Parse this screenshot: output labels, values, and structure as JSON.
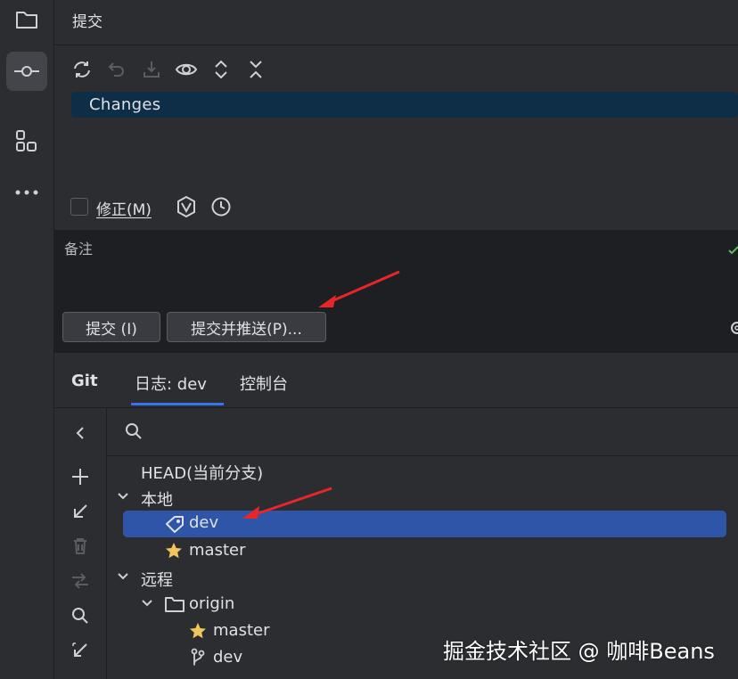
{
  "activity_bar": {
    "items": [
      {
        "name": "project",
        "icon": "folder-icon"
      },
      {
        "name": "commit",
        "icon": "commit-icon",
        "active": true
      },
      {
        "name": "structure",
        "icon": "structure-icon"
      },
      {
        "name": "more",
        "icon": "more-icon"
      }
    ]
  },
  "commit_panel": {
    "title": "提交",
    "toolbar": [
      "refresh-icon",
      "rollback-icon",
      "shelve-icon",
      "eye-icon",
      "expand-all-icon",
      "collapse-all-icon"
    ],
    "changes_label": "Changes",
    "amend_label": "修正(M)",
    "message_placeholder": "备注",
    "commit_button": "提交 (I)",
    "commit_push_button": "提交并推送(P)..."
  },
  "bottom_tabs": {
    "git": "Git",
    "log": "日志: dev",
    "console": "控制台"
  },
  "branches": {
    "head": "HEAD(当前分支)",
    "local_group": "本地",
    "local": [
      {
        "name": "dev",
        "icon": "tag-icon",
        "selected": true
      },
      {
        "name": "master",
        "icon": "star-icon"
      }
    ],
    "remote_group": "远程",
    "remote_folder": "origin",
    "remote": [
      {
        "name": "master",
        "icon": "star-icon"
      },
      {
        "name": "dev",
        "icon": "branch-icon"
      }
    ]
  },
  "watermark": "掘金技术社区 @ 咖啡Beans",
  "colors": {
    "background": "#2b2d30",
    "selection": "#2e55a8",
    "changes_row": "#0e2e48",
    "accent": "#3574f0",
    "star": "#f2c55c",
    "annotation_arrow": "#e8262a"
  }
}
